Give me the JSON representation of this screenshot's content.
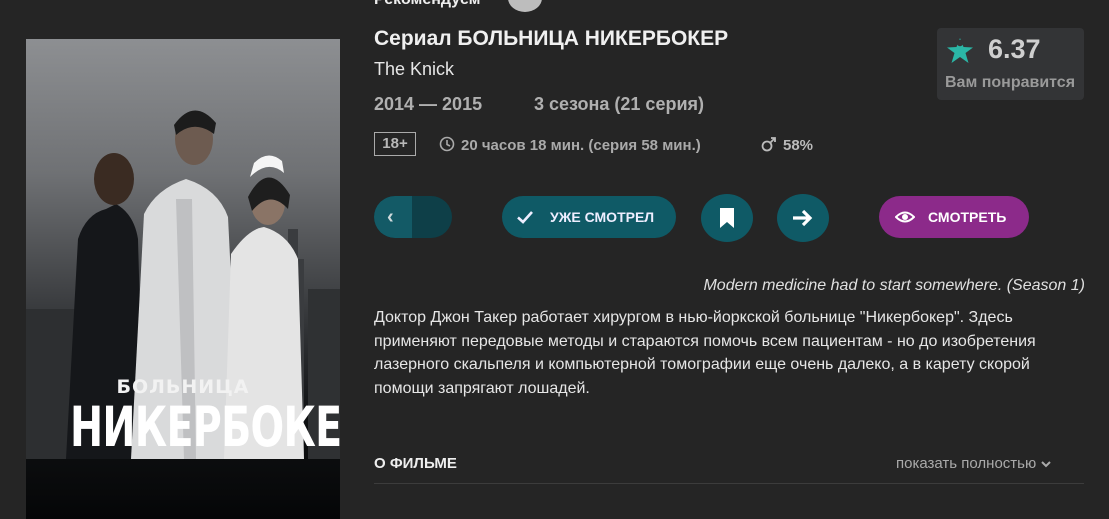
{
  "header": {
    "section_title_cut": "Рекомендуем"
  },
  "poster": {
    "title_small": "БОЛЬНИЦА",
    "title_big": "НИКЕРБОКЕР"
  },
  "movie": {
    "title": "Сериал БОЛЬНИЦА НИКЕРБОКЕР",
    "original_title": "The Knick",
    "years": "2014 — 2015",
    "seasons": "3 сезона (21 серия)",
    "age_rating": "18+",
    "duration": "20 часов 18 мин. (серия 58 мин.)",
    "male_percent": "58%",
    "tagline": "Modern medicine had to start somewhere. (Season 1)",
    "description": "Доктор Джон Такер работает хирургом в нью-йоркской больнице \"Никербокер\". Здесь применяют передовые методы и стараются помочь всем пациентам - но до изобретения лазерного скальпеля и компьютерной томографии еще очень далеко, а в карету скорой помощи запрягают лошадей."
  },
  "rating": {
    "value": "6.37",
    "hint": "Вам понравится",
    "icon": "star-person-icon",
    "color": "#2bb6a6"
  },
  "actions": {
    "watched_label": "УЖЕ СМОТРЕЛ",
    "watch_label": "СМОТРЕТЬ",
    "prev_glyph": "‹",
    "teal_color": "#0f5a66",
    "purple_color": "#8c2a8a"
  },
  "about": {
    "label": "О ФИЛЬМЕ",
    "expand_label": "показать полностью"
  }
}
